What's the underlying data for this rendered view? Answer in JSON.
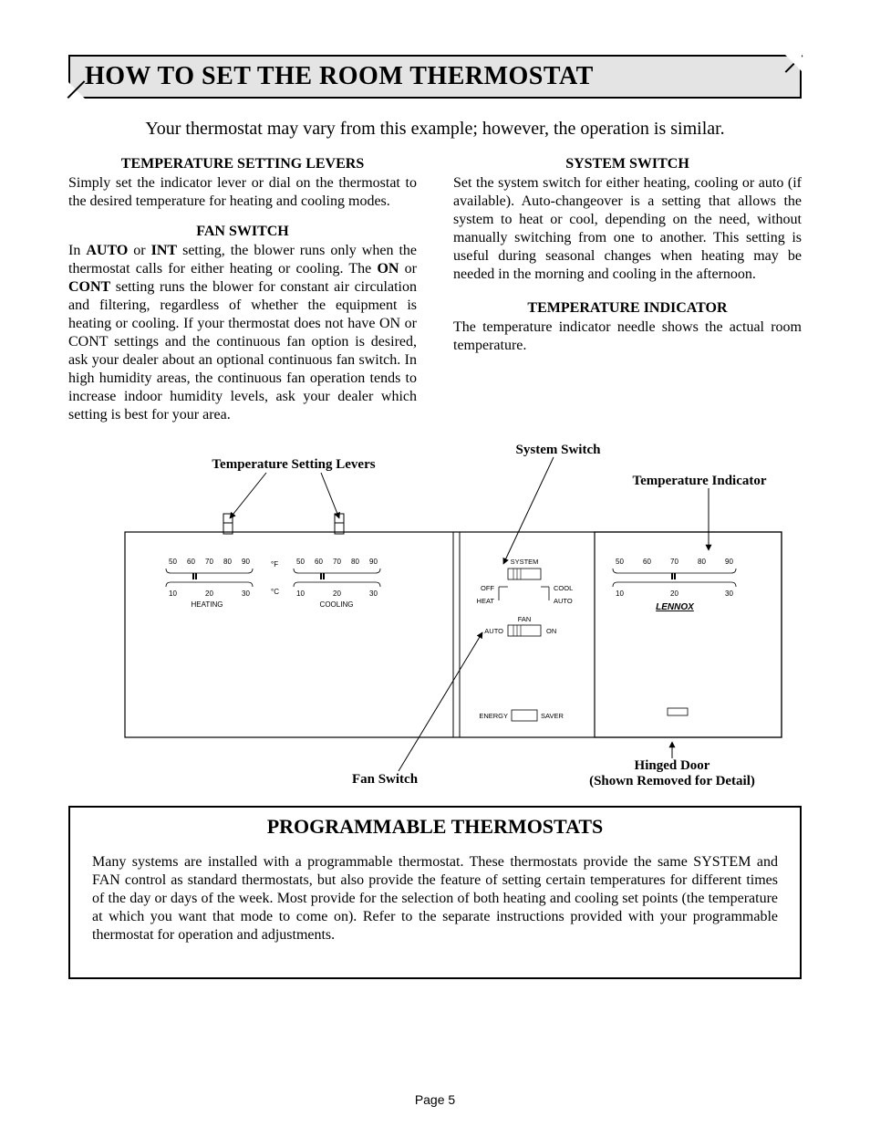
{
  "title": "HOW TO SET THE ROOM THERMOSTAT",
  "intro": "Your thermostat may vary from this example; however, the operation is similar.",
  "sections": {
    "temp_levers": {
      "head": "TEMPERATURE SETTING LEVERS",
      "body": "Simply set the indicator lever or dial on the thermostat to the desired temperature for heating and cooling modes."
    },
    "fan_switch": {
      "head": "FAN SWITCH",
      "body_pre": "In ",
      "b1": "AUTO",
      "mid1": " or ",
      "b2": "INT",
      "mid2": " setting, the blower runs only when the thermostat calls for either heating or cooling. The ",
      "b3": "ON",
      "mid3": " or ",
      "b4": "CONT",
      "body_post": " setting runs the blower for constant air circulation and filtering, regardless of whether the equipment is heating or cooling.  If your thermostat does not have ON or CONT settings and the continuous fan option is desired, ask your dealer about an optional continuous fan switch. In high humidity areas, the continuous fan operation tends to increase indoor humidity levels, ask your dealer which setting is best for your area."
    },
    "system_switch": {
      "head": "SYSTEM SWITCH",
      "body": "Set the system switch for either heating, cooling or auto (if available). Auto-changeover is a setting that allows the system to heat or cool, depending on the need, without manually switching from one to another. This setting is useful during seasonal changes when heating may be needed in the morning and cooling in the afternoon."
    },
    "temp_indicator": {
      "head": "TEMPERATURE INDICATOR",
      "body": "The temperature indicator needle shows the actual room temperature."
    }
  },
  "diagram": {
    "callouts": {
      "temp_levers": "Temperature Setting Levers",
      "system_switch": "System Switch",
      "temp_indicator": "Temperature Indicator",
      "fan_switch": "Fan Switch",
      "hinged_door_line1": "Hinged Door",
      "hinged_door_line2": "(Shown Removed for Detail)"
    },
    "scale_f": [
      "50",
      "60",
      "70",
      "80",
      "90"
    ],
    "scale_c": [
      "10",
      "20",
      "30"
    ],
    "unit_f": "°F",
    "unit_c": "°C",
    "panel_heating": "HEATING",
    "panel_cooling": "COOLING",
    "sys_label": "SYSTEM",
    "sys_off": "OFF",
    "sys_heat": "HEAT",
    "sys_cool": "COOL",
    "sys_auto": "AUTO",
    "fan_label": "FAN",
    "fan_auto": "AUTO",
    "fan_on": "ON",
    "energy": "ENERGY",
    "saver": "SAVER",
    "brand": "LENNOX"
  },
  "programmable": {
    "head": "PROGRAMMABLE THERMOSTATS",
    "body": "Many systems are installed with a programmable thermostat. These thermostats provide the same SYSTEM and FAN control as standard thermostats, but also provide the feature of setting certain temperatures for different times of the day or days of the week. Most provide for the selection of  both heating and cooling set points (the temperature at which you want that mode to come on). Refer to the separate instructions provided with your programmable thermostat for operation and adjustments."
  },
  "page_number": "Page 5"
}
